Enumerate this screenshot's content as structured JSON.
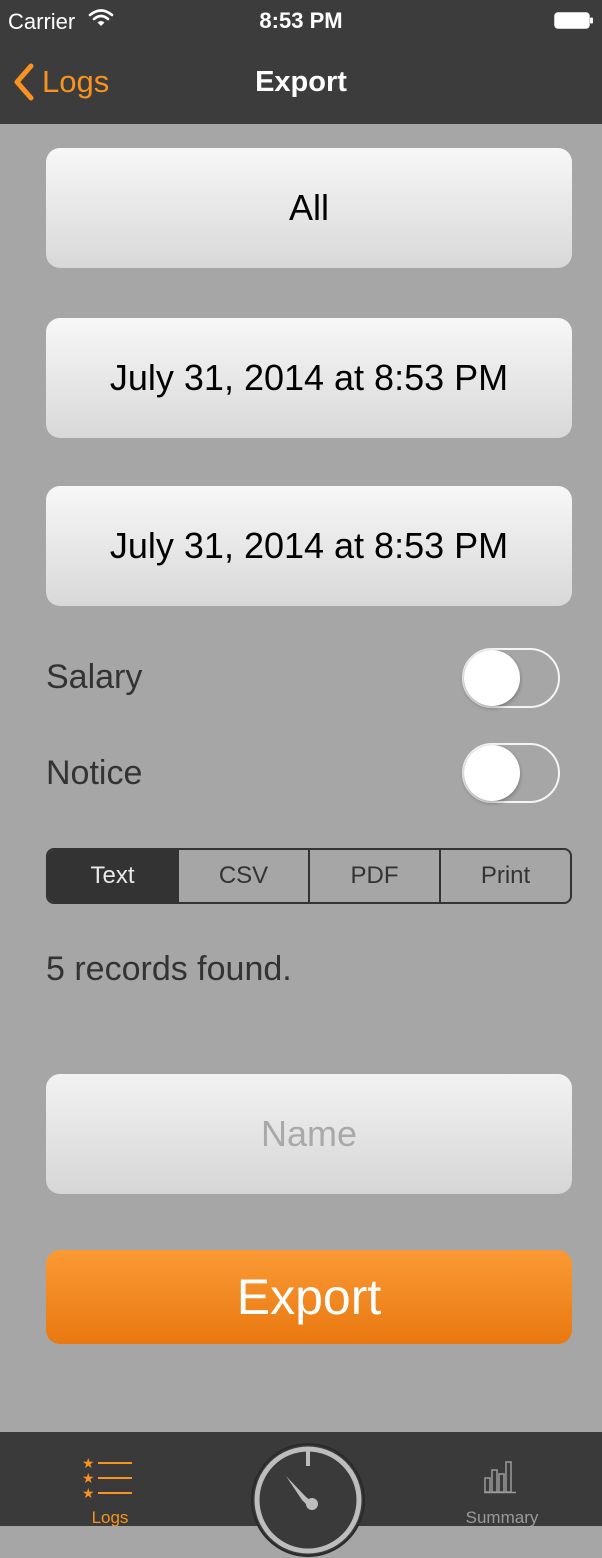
{
  "status_bar": {
    "carrier": "Carrier",
    "time": "8:53 PM",
    "wifi_icon": "wifi-icon",
    "battery_icon": "battery-icon"
  },
  "nav": {
    "back_label": "Logs",
    "title": "Export",
    "back_icon": "chevron-left-icon"
  },
  "filters": {
    "scope_label": "All",
    "start_date": "July 31, 2014 at 8:53 PM",
    "end_date": "July 31, 2014 at 8:53 PM"
  },
  "switches": [
    {
      "label": "Salary",
      "on": false
    },
    {
      "label": "Notice",
      "on": false
    }
  ],
  "format_segments": {
    "options": [
      "Text",
      "CSV",
      "PDF",
      "Print"
    ],
    "selected": "Text"
  },
  "records_text": "5 records found.",
  "name_field": {
    "value": "",
    "placeholder": "Name"
  },
  "export_button_label": "Export",
  "tab_bar": {
    "items": [
      {
        "label": "Logs",
        "icon": "list-stars-icon",
        "active": true
      },
      {
        "label": "",
        "icon": "stopwatch-icon",
        "active": false
      },
      {
        "label": "Summary",
        "icon": "bar-chart-icon",
        "active": false
      }
    ]
  },
  "colors": {
    "accent": "#f7931e",
    "bar_background": "#3c3c3c",
    "page_background": "#a6a6a6"
  }
}
